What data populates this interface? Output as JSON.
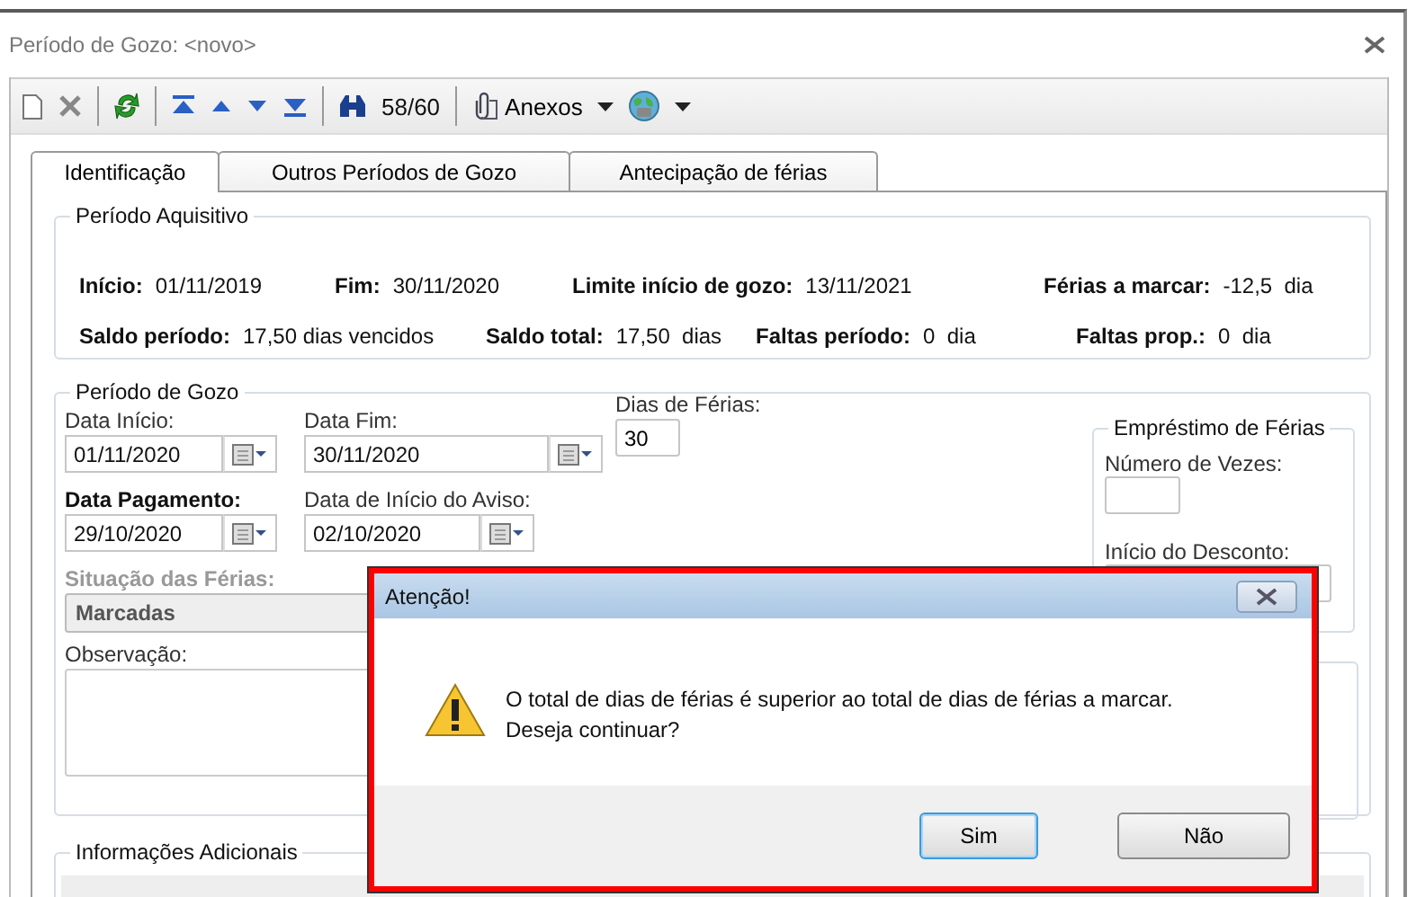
{
  "window": {
    "title": "Período de Gozo: <novo>"
  },
  "toolbar": {
    "record_counter": "58/60",
    "attachments_button": "Anexos"
  },
  "tabs": [
    {
      "label": "Identificação",
      "selected": true
    },
    {
      "label": "Outros Períodos de Gozo",
      "selected": false
    },
    {
      "label": "Antecipação de férias",
      "selected": false
    }
  ],
  "periodo_aquisitivo": {
    "title": "Período Aquisitivo",
    "fields": [
      {
        "label": "Início:",
        "value": "01/11/2019"
      },
      {
        "label": "Fim:",
        "value": "30/11/2020"
      },
      {
        "label": "Limite início de gozo:",
        "value": "13/11/2021"
      },
      {
        "label": "Férias a marcar:",
        "value": "-12,5  dia"
      },
      {
        "label": "Saldo período:",
        "value": "17,50 dias vencidos"
      },
      {
        "label": "Saldo total:",
        "value": "17,50  dias"
      },
      {
        "label": "Faltas período:",
        "value": "0  dia"
      },
      {
        "label": "Faltas prop.:",
        "value": "0  dia"
      }
    ]
  },
  "periodo_gozo": {
    "title": "Período de Gozo",
    "data_inicio": {
      "label": "Data Início:",
      "value": "01/11/2020"
    },
    "data_fim": {
      "label": "Data Fim:",
      "value": "30/11/2020"
    },
    "dias_ferias": {
      "label": "Dias de Férias:",
      "value": "30"
    },
    "data_pagamento": {
      "label": "Data Pagamento:",
      "value": "29/10/2020"
    },
    "data_aviso": {
      "label": "Data de Início do Aviso:",
      "value": "02/10/2020"
    },
    "situacao": {
      "label": "Situação das Férias:",
      "value": "Marcadas",
      "disabled": true
    },
    "observacao": {
      "label": "Observação:"
    },
    "emprestimo": {
      "title": "Empréstimo de Férias",
      "numero_vezes": {
        "label": "Número de Vezes:"
      },
      "inicio_desconto": {
        "label": "Início do Desconto:"
      }
    }
  },
  "informacoes_adicionais": {
    "title": "Informações Adicionais"
  },
  "dialog": {
    "title": "Atenção!",
    "message_lines": [
      "O total de dias de férias é superior ao total de dias de férias a marcar.",
      "Deseja continuar?"
    ],
    "buttons": [
      {
        "label": "Sim",
        "focused": true
      },
      {
        "label": "Não",
        "focused": false
      }
    ]
  }
}
